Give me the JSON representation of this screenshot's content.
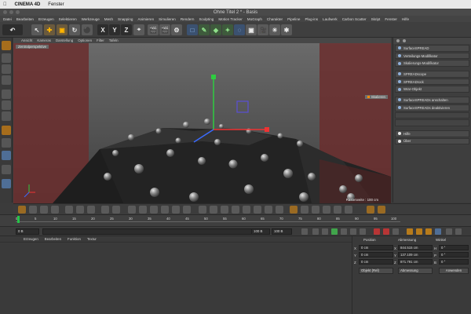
{
  "mac_menu": {
    "app": "CINEMA 4D",
    "menu": "Fenster"
  },
  "window": {
    "title": "Ohne Titel 2 * - Basis"
  },
  "menubar": {
    "items": [
      "Datei",
      "Bearbeiten",
      "Erzeugen",
      "Selektieren",
      "Werkzeuge",
      "Mesh",
      "Snapping",
      "Animieren",
      "Simulieren",
      "Rendern",
      "Sculpting",
      "Motion Tracker",
      "MoGraph",
      "Charakter",
      "Pipeline",
      "Plug-ins",
      "Laufwerk",
      "Carbon Scatter",
      "Skript",
      "Fenster",
      "Hilfe"
    ]
  },
  "toolbar": {
    "axis_x": "X",
    "axis_y": "Y",
    "axis_z": "Z"
  },
  "viewport": {
    "menu": [
      "Ansicht",
      "Kameras",
      "Darstellung",
      "Optionen",
      "Filter",
      "Tafeln"
    ],
    "label": "Zentralperspektive",
    "overlay": "Skalieren",
    "footer": "Rasterweite : 100 cm"
  },
  "object_manager": {
    "items": [
      {
        "label": "SurfaceSPREAD",
        "style": "normal"
      },
      {
        "label": "Verteilungs-Modifikator",
        "style": "normal"
      },
      {
        "label": "Skalierungs-Modifikator",
        "style": "normal"
      },
      {
        "label": "SPREADscope",
        "style": "normal"
      },
      {
        "label": "SPREADrock",
        "style": "normal"
      },
      {
        "label": "Wrar-Objekt",
        "style": "normal"
      },
      {
        "label": "SurfaceSPREADs anschalten",
        "style": "normal"
      },
      {
        "label": "SurfaceSPREADs deaktivieren",
        "style": "normal"
      },
      {
        "label": "",
        "style": "dim"
      },
      {
        "label": "",
        "style": "dim"
      },
      {
        "label": "Hilfe",
        "style": "light"
      },
      {
        "label": "Über",
        "style": "light"
      }
    ]
  },
  "timeline": {
    "ticks": [
      "0",
      "5",
      "10",
      "15",
      "20",
      "25",
      "30",
      "35",
      "40",
      "45",
      "50",
      "55",
      "60",
      "65",
      "70",
      "75",
      "80",
      "85",
      "90",
      "95",
      "100"
    ]
  },
  "transport": {
    "start": "0 B",
    "current": "0 B",
    "end_field": "100 B",
    "end": "100 B"
  },
  "materials": {
    "menu": [
      "Erzeugen",
      "Bearbeiten",
      "Funktion",
      "Textur"
    ]
  },
  "coordinates": {
    "headers": [
      "Position",
      "Abmessung",
      "Winkel"
    ],
    "rows": [
      {
        "axis": "X",
        "pos": "0 cm",
        "size": "844.515 cm",
        "rot_axis": "H",
        "rot": "0 °"
      },
      {
        "axis": "Y",
        "pos": "0 cm",
        "size": "137.109 cm",
        "rot_axis": "P",
        "rot": "0 °"
      },
      {
        "axis": "Z",
        "pos": "0 cm",
        "size": "871.791 cm",
        "rot_axis": "B",
        "rot": "0 °"
      }
    ],
    "mode": "Objekt (Rel)",
    "size_mode": "Abmessung",
    "apply": "Anwenden"
  },
  "colors": {
    "accent": "#ffb400",
    "play": "#41a44b",
    "record": "#b73535",
    "safe_frame": "#7a2a2a"
  }
}
